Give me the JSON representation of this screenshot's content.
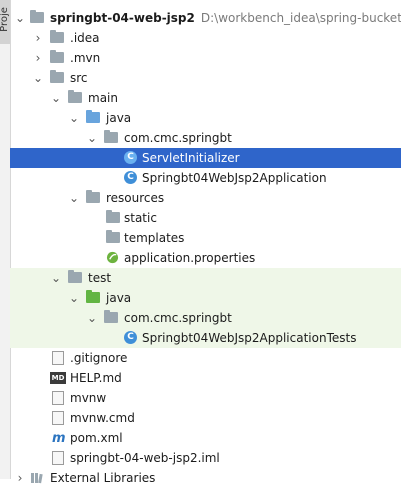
{
  "side_tab_label": "Proje",
  "project": {
    "name": "springbt-04-web-jsp2",
    "path": "D:\\workbench_idea\\spring-bucket\\sp"
  },
  "tree": {
    "idea": ".idea",
    "mvn": ".mvn",
    "src": "src",
    "main": "main",
    "java": "java",
    "package": "com.cmc.springbt",
    "servlet_initializer": "ServletInitializer",
    "application": "Springbt04WebJsp2Application",
    "resources": "resources",
    "static": "static",
    "templates": "templates",
    "app_properties": "application.properties",
    "test": "test",
    "test_java": "java",
    "test_package": "com.cmc.springbt",
    "app_tests": "Springbt04WebJsp2ApplicationTests",
    "gitignore": ".gitignore",
    "help_md": "HELP.md",
    "mvnw": "mvnw",
    "mvnw_cmd": "mvnw.cmd",
    "pom": "pom.xml",
    "iml": "springbt-04-web-jsp2.iml",
    "external_libraries": "External Libraries"
  },
  "icons": {
    "md_badge": "MD",
    "class_badge": "C",
    "maven_badge": "m"
  },
  "colors": {
    "selection": "#2f65ca",
    "test_tint": "#eff7e8",
    "source_folder": "#68a4dd",
    "test_folder": "#62b543",
    "plain_folder": "#9aa7b0"
  }
}
